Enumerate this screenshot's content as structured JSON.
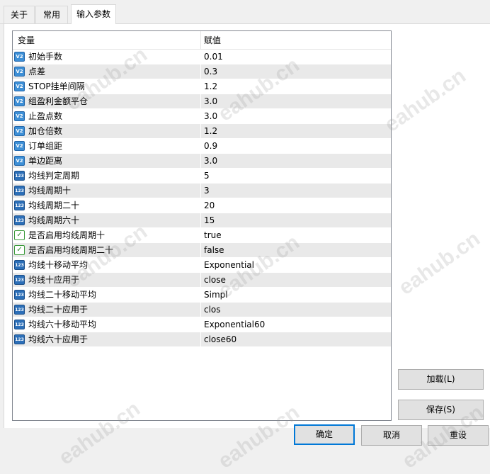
{
  "tabs": [
    {
      "label": "关于"
    },
    {
      "label": "常用"
    },
    {
      "label": "输入参数"
    }
  ],
  "grid": {
    "headers": {
      "name": "变量",
      "value": "赋值"
    },
    "rows": [
      {
        "name": "初始手数",
        "value": "0.01",
        "icon": "double-icon",
        "icon_text": "V2"
      },
      {
        "name": "点差",
        "value": "0.3",
        "icon": "double-icon",
        "icon_text": "V2"
      },
      {
        "name": "STOP挂单间隔",
        "value": "1.2",
        "icon": "double-icon",
        "icon_text": "V2"
      },
      {
        "name": "组盈利金额平仓",
        "value": "3.0",
        "icon": "double-icon",
        "icon_text": "V2"
      },
      {
        "name": "止盈点数",
        "value": "3.0",
        "icon": "double-icon",
        "icon_text": "V2"
      },
      {
        "name": "加仓倍数",
        "value": "1.2",
        "icon": "double-icon",
        "icon_text": "V2"
      },
      {
        "name": "订单组距",
        "value": "0.9",
        "icon": "double-icon",
        "icon_text": "V2"
      },
      {
        "name": "单边距离",
        "value": "3.0",
        "icon": "double-icon",
        "icon_text": "V2"
      },
      {
        "name": "均线判定周期",
        "value": "5",
        "icon": "integer-icon",
        "icon_text": "123"
      },
      {
        "name": "均线周期十",
        "value": "3",
        "icon": "integer-icon",
        "icon_text": "123"
      },
      {
        "name": "均线周期二十",
        "value": "20",
        "icon": "integer-icon",
        "icon_text": "123"
      },
      {
        "name": "均线周期六十",
        "value": "15",
        "icon": "integer-icon",
        "icon_text": "123"
      },
      {
        "name": "是否启用均线周期十",
        "value": "true",
        "icon": "boolean-icon",
        "icon_text": "✓"
      },
      {
        "name": "是否启用均线周期二十",
        "value": "false",
        "icon": "boolean-icon",
        "icon_text": "✓"
      },
      {
        "name": "均线十移动平均",
        "value": "Exponential",
        "icon": "enum-icon",
        "icon_text": "123"
      },
      {
        "name": "均线十应用于",
        "value": "close",
        "icon": "enum-icon",
        "icon_text": "123"
      },
      {
        "name": "均线二十移动平均",
        "value": "Simpl",
        "icon": "enum-icon",
        "icon_text": "123"
      },
      {
        "name": "均线二十应用于",
        "value": "clos",
        "icon": "enum-icon",
        "icon_text": "123"
      },
      {
        "name": "均线六十移动平均",
        "value": "Exponential60",
        "icon": "enum-icon",
        "icon_text": "123"
      },
      {
        "name": "均线六十应用于",
        "value": "close60",
        "icon": "enum-icon",
        "icon_text": "123"
      }
    ]
  },
  "buttons": {
    "load": "加载(L)",
    "save": "保存(S)",
    "ok": "确定",
    "cancel": "取消",
    "reset": "重设"
  },
  "watermark": "eahub.cn"
}
